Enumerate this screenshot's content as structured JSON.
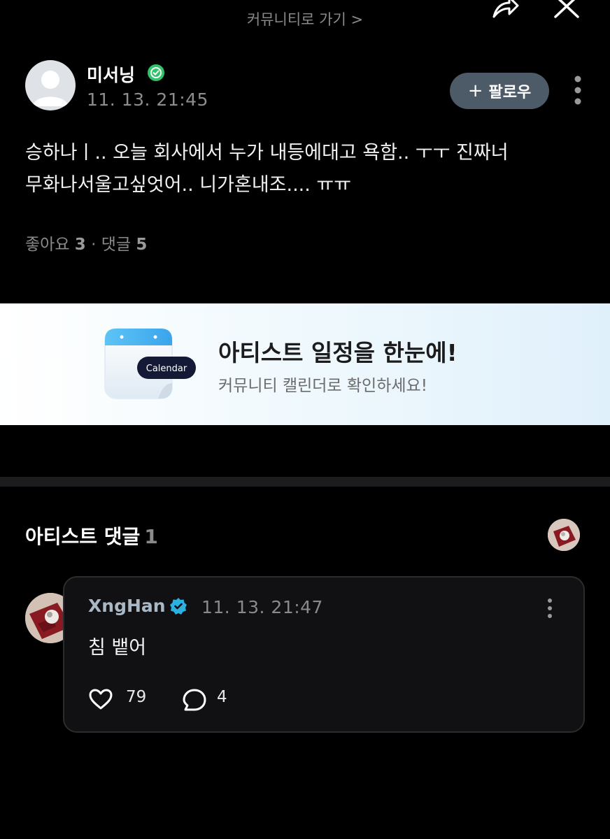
{
  "topbar": {
    "community_link": "커뮤니티로 가기 >",
    "share_icon": "share-icon",
    "close_icon": "close-icon"
  },
  "post": {
    "author": "미서닝",
    "timestamp": "11. 13. 21:45",
    "follow_label": "팔로우",
    "follow_plus": "+",
    "body_line1": "승하나ㅣ.. 오늘 회사에서 누가 내등에대고 욕함.. ㅜㅜ 진짜너",
    "body_line2": "무화나서울고싶엇어.. 니가혼내조.... ㅠㅠ",
    "likes_label": "좋아요",
    "likes_count": "3",
    "separator": "·",
    "comments_label": "댓글",
    "comments_count": "5"
  },
  "banner": {
    "badge_label": "Calendar",
    "title": "아티스트 일정을 한눈에!",
    "subtitle": "커뮤니티 캘린더로 확인하세요!"
  },
  "artist_comments": {
    "section_title": "아티스트 댓글",
    "count": "1",
    "comment": {
      "author": "XngHan",
      "timestamp": "11. 13. 21:47",
      "text": "침 뱉어",
      "likes": "79",
      "replies": "4"
    }
  },
  "colors": {
    "background": "#000000",
    "follow_button": "#4d5a67",
    "verified_green": "#2fc46a",
    "verified_blue": "#2bb0e0",
    "card_background": "#111113"
  }
}
